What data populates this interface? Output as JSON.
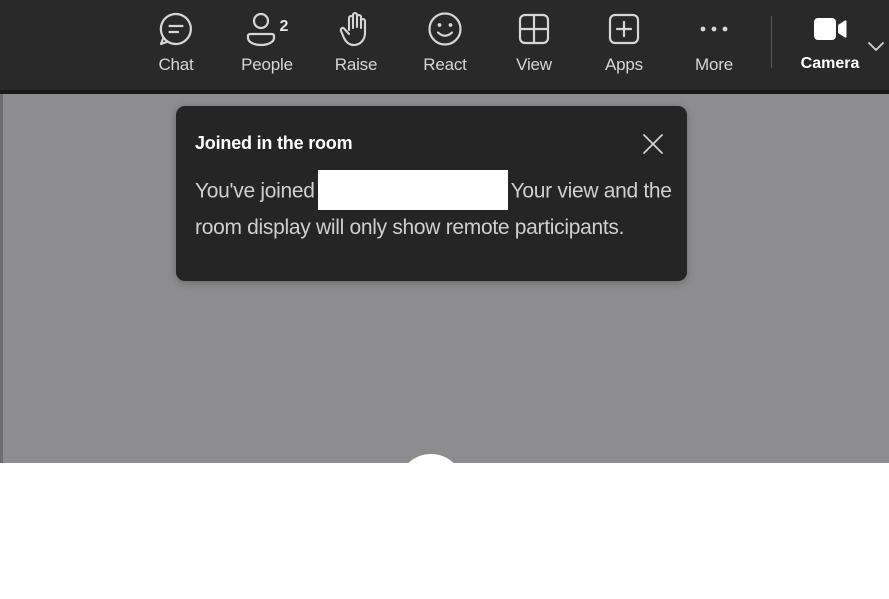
{
  "toolbar": {
    "buttons": [
      {
        "label": "Chat",
        "icon": "chat-icon"
      },
      {
        "label": "People",
        "icon": "people-icon",
        "count": "2"
      },
      {
        "label": "Raise",
        "icon": "raise-hand-icon"
      },
      {
        "label": "React",
        "icon": "smiley-icon"
      },
      {
        "label": "View",
        "icon": "grid-view-icon"
      },
      {
        "label": "Apps",
        "icon": "add-app-icon"
      },
      {
        "label": "More",
        "icon": "more-dots-icon"
      },
      {
        "label": "Camera",
        "icon": "video-camera-icon"
      }
    ],
    "camera_options_icon": "chevron-down-icon"
  },
  "toast": {
    "title": "Joined in the room",
    "body_prefix": "You've joined",
    "body_suffix": "Your view and the room display will only show remote participants.",
    "close_icon": "close-icon"
  },
  "colors": {
    "toolbar_bg": "#292929",
    "stage_bg": "#8d8c8e",
    "toast_bg": "#252525",
    "icon_color": "#d6d6d6"
  }
}
